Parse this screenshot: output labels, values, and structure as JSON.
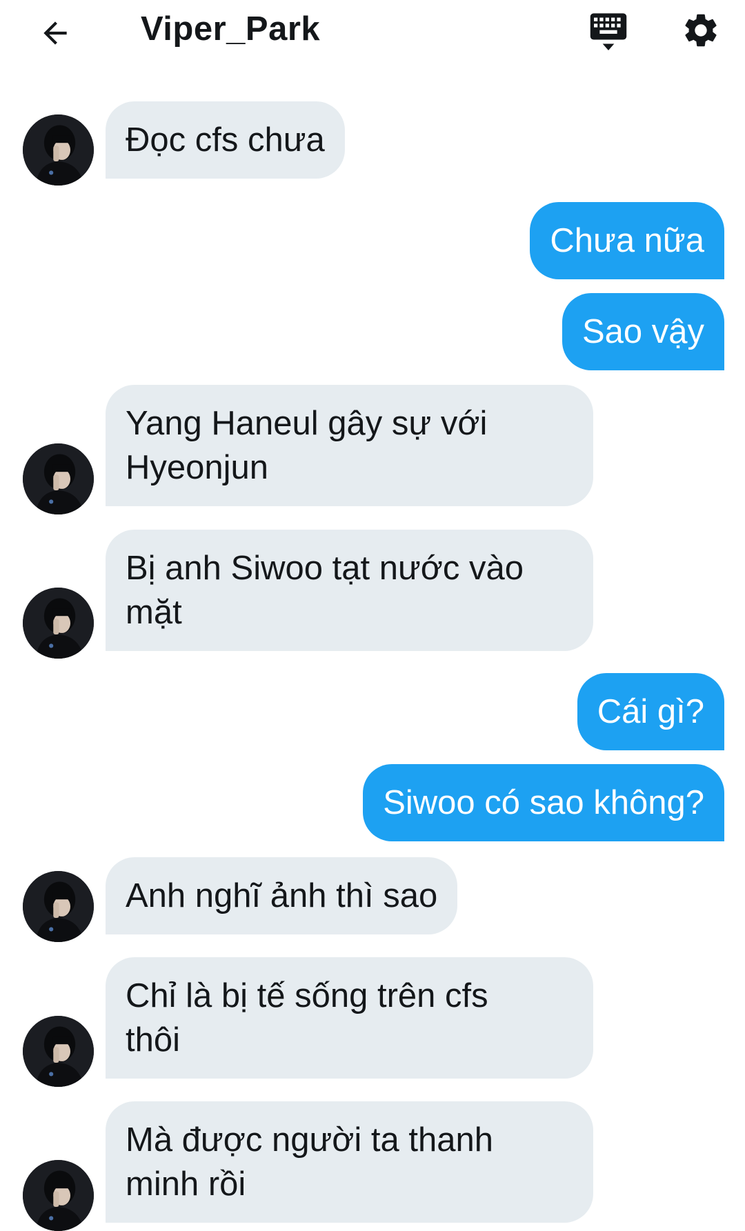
{
  "header": {
    "title": "Viper_Park",
    "back_icon": "arrow-left-icon",
    "keyboard_icon": "keyboard-icon",
    "settings_icon": "gear-icon"
  },
  "colors": {
    "incoming_bubble": "#e6ecf0",
    "outgoing_bubble": "#1da1f2",
    "incoming_text": "#14171a",
    "outgoing_text": "#ffffff"
  },
  "messages": [
    {
      "direction": "in",
      "text": "Đọc cfs chưa"
    },
    {
      "direction": "out",
      "text": "Chưa nữa"
    },
    {
      "direction": "out",
      "text": "Sao vậy"
    },
    {
      "direction": "in",
      "text": "Yang Haneul gây sự với\nHyeonjun"
    },
    {
      "direction": "in",
      "text": "Bị anh Siwoo tạt nước vào\nmặt"
    },
    {
      "direction": "out",
      "text": "Cái gì?"
    },
    {
      "direction": "out",
      "text": "Siwoo có sao không?"
    },
    {
      "direction": "in",
      "text": "Anh nghĩ ảnh thì sao"
    },
    {
      "direction": "in",
      "text": "Chỉ là bị tế sống trên cfs\nthôi"
    },
    {
      "direction": "in",
      "text": "Mà được người ta thanh\nminh rồi"
    }
  ]
}
